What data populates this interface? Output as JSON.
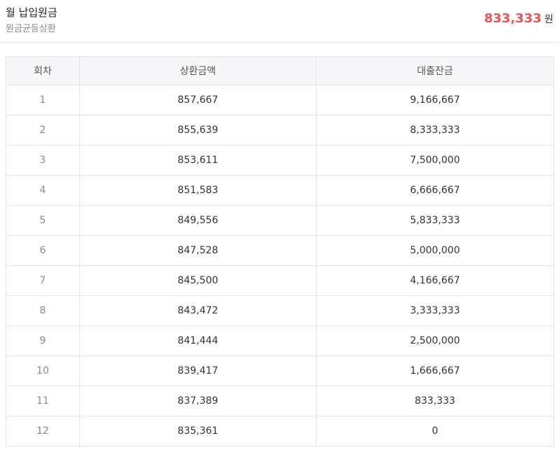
{
  "summary": {
    "title": "월 납입원금",
    "subtitle": "원금균등상환",
    "amount": "833,333",
    "unit": "원",
    "accent_color": "#f0504f"
  },
  "table": {
    "headers": [
      "회차",
      "상환금액",
      "대출잔금"
    ],
    "rows": [
      [
        "1",
        "857,667",
        "9,166,667"
      ],
      [
        "2",
        "855,639",
        "8,333,333"
      ],
      [
        "3",
        "853,611",
        "7,500,000"
      ],
      [
        "4",
        "851,583",
        "6,666,667"
      ],
      [
        "5",
        "849,556",
        "5,833,333"
      ],
      [
        "6",
        "847,528",
        "5,000,000"
      ],
      [
        "7",
        "845,500",
        "4,166,667"
      ],
      [
        "8",
        "843,472",
        "3,333,333"
      ],
      [
        "9",
        "841,444",
        "2,500,000"
      ],
      [
        "10",
        "839,417",
        "1,666,667"
      ],
      [
        "11",
        "837,389",
        "833,333"
      ],
      [
        "12",
        "835,361",
        "0"
      ]
    ]
  }
}
